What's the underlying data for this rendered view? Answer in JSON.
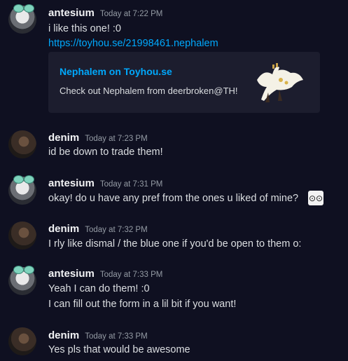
{
  "messages": [
    {
      "author": "antesium",
      "time": "Today at 7:22 PM",
      "lines": [
        "i like this one! :0"
      ],
      "link": "https://toyhou.se/21998461.nephalem",
      "embed": {
        "title": "Nephalem on Toyhou.se",
        "description": "Check out Nephalem from deerbroken@TH!"
      }
    },
    {
      "author": "denim",
      "time": "Today at 7:23 PM",
      "lines": [
        "id be down to trade them!"
      ]
    },
    {
      "author": "antesium",
      "time": "Today at 7:31 PM",
      "lines": [
        "okay! do u have any pref from the ones u liked of mine?"
      ]
    },
    {
      "author": "denim",
      "time": "Today at 7:32 PM",
      "lines": [
        "I rly like dismal / the blue one if you'd be open to them o:"
      ]
    },
    {
      "author": "antesium",
      "time": "Today at 7:33 PM",
      "lines": [
        "Yeah I can do them! :0",
        "I can fill out the form in a lil bit if you want!"
      ]
    },
    {
      "author": "denim",
      "time": "Today at 7:33 PM",
      "lines": [
        "Yes pls that would be awesome"
      ]
    }
  ],
  "icons": {
    "custom_emoji": "shocked-face-emoji",
    "avatar_antesium": "anime-avatar",
    "avatar_denim": "deer-avatar"
  },
  "colors": {
    "background": "#0f1021",
    "link": "#00a8fc",
    "embed_bg": "#1c1d2e"
  }
}
